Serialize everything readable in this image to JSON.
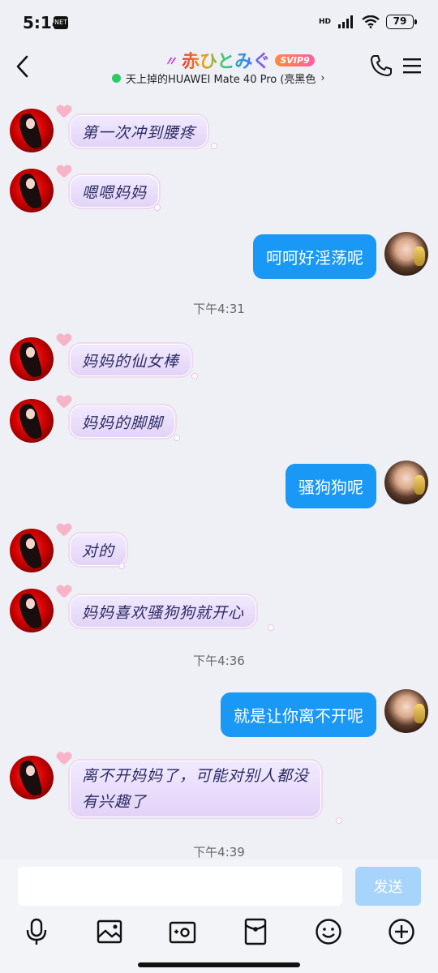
{
  "status": {
    "time": "5:14",
    "badge": "NET",
    "network": "HD",
    "battery": "79"
  },
  "header": {
    "title_prefix": "〃",
    "title": "赤ひとみぐ",
    "svip": "SVIP9",
    "device": "天上掉的HUAWEI Mate 40 Pro (亮黑色",
    "device_arrow": "›"
  },
  "messages": [
    {
      "from": "other",
      "text": "第一次冲到腰疼"
    },
    {
      "from": "other",
      "text": "嗯嗯妈妈"
    },
    {
      "from": "self",
      "text": "呵呵好淫荡呢"
    },
    {
      "from": "time",
      "text": "下午4:31"
    },
    {
      "from": "other",
      "text": "妈妈的仙女棒"
    },
    {
      "from": "other",
      "text": "妈妈的脚脚"
    },
    {
      "from": "self",
      "text": "骚狗狗呢"
    },
    {
      "from": "other",
      "text": "对的"
    },
    {
      "from": "other",
      "text": "妈妈喜欢骚狗狗就开心"
    },
    {
      "from": "time",
      "text": "下午4:36"
    },
    {
      "from": "self",
      "text": "就是让你离不开呢"
    },
    {
      "from": "other",
      "text": "离不开妈妈了，可能对别人都没",
      "text2": "有兴趣了"
    },
    {
      "from": "time",
      "text": "下午4:39"
    }
  ],
  "input": {
    "value": "",
    "placeholder": "",
    "send_label": "发送"
  },
  "toolbar": [
    "microphone-icon",
    "image-icon",
    "camera-icon",
    "red-packet-icon",
    "emoji-icon",
    "plus-icon"
  ],
  "colors": {
    "self_bubble": "#1a98f6",
    "send_disabled": "#a7d4fb",
    "online": "#2bcb63"
  }
}
